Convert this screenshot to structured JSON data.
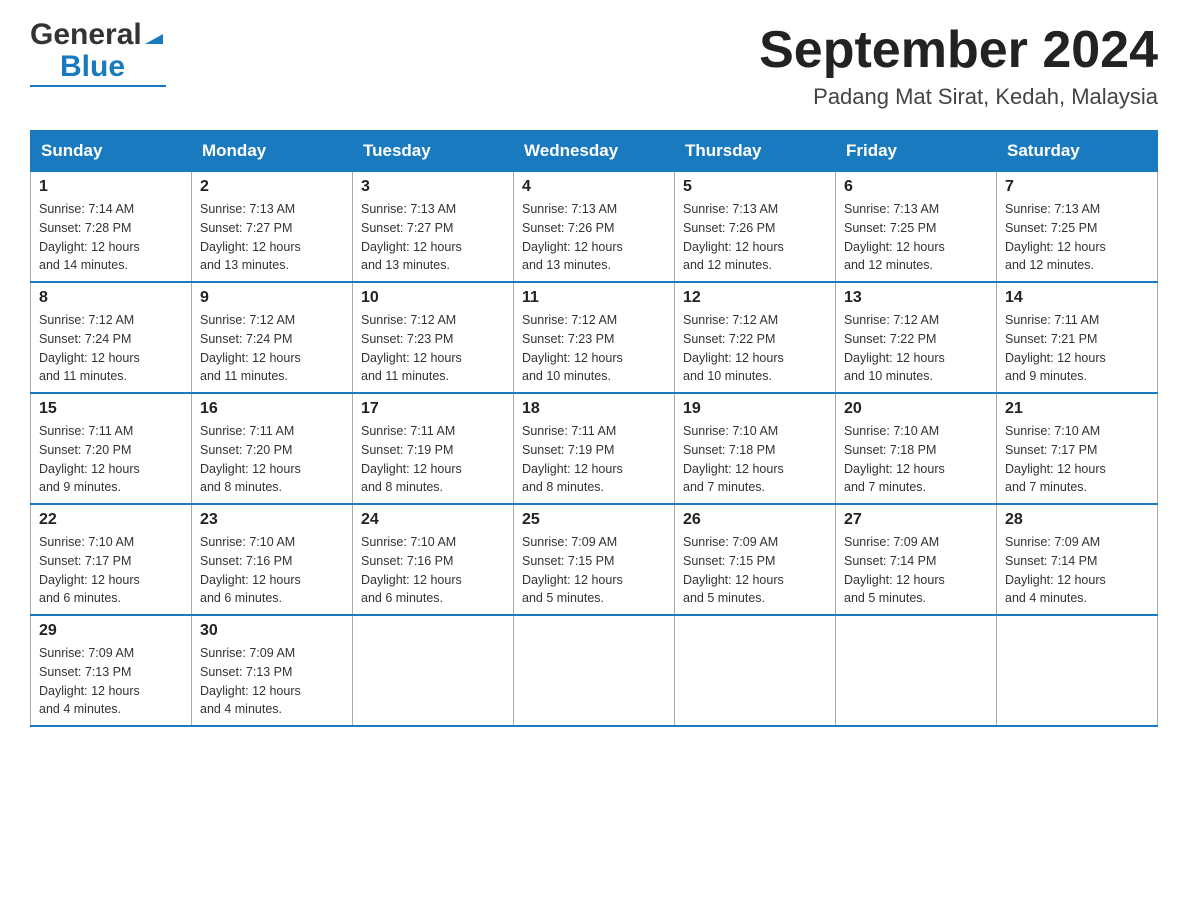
{
  "header": {
    "title": "September 2024",
    "subtitle": "Padang Mat Sirat, Kedah, Malaysia",
    "logo_general": "General",
    "logo_blue": "Blue"
  },
  "days_of_week": [
    "Sunday",
    "Monday",
    "Tuesday",
    "Wednesday",
    "Thursday",
    "Friday",
    "Saturday"
  ],
  "weeks": [
    [
      {
        "day": "1",
        "sunrise": "7:14 AM",
        "sunset": "7:28 PM",
        "daylight": "12 hours and 14 minutes."
      },
      {
        "day": "2",
        "sunrise": "7:13 AM",
        "sunset": "7:27 PM",
        "daylight": "12 hours and 13 minutes."
      },
      {
        "day": "3",
        "sunrise": "7:13 AM",
        "sunset": "7:27 PM",
        "daylight": "12 hours and 13 minutes."
      },
      {
        "day": "4",
        "sunrise": "7:13 AM",
        "sunset": "7:26 PM",
        "daylight": "12 hours and 13 minutes."
      },
      {
        "day": "5",
        "sunrise": "7:13 AM",
        "sunset": "7:26 PM",
        "daylight": "12 hours and 12 minutes."
      },
      {
        "day": "6",
        "sunrise": "7:13 AM",
        "sunset": "7:25 PM",
        "daylight": "12 hours and 12 minutes."
      },
      {
        "day": "7",
        "sunrise": "7:13 AM",
        "sunset": "7:25 PM",
        "daylight": "12 hours and 12 minutes."
      }
    ],
    [
      {
        "day": "8",
        "sunrise": "7:12 AM",
        "sunset": "7:24 PM",
        "daylight": "12 hours and 11 minutes."
      },
      {
        "day": "9",
        "sunrise": "7:12 AM",
        "sunset": "7:24 PM",
        "daylight": "12 hours and 11 minutes."
      },
      {
        "day": "10",
        "sunrise": "7:12 AM",
        "sunset": "7:23 PM",
        "daylight": "12 hours and 11 minutes."
      },
      {
        "day": "11",
        "sunrise": "7:12 AM",
        "sunset": "7:23 PM",
        "daylight": "12 hours and 10 minutes."
      },
      {
        "day": "12",
        "sunrise": "7:12 AM",
        "sunset": "7:22 PM",
        "daylight": "12 hours and 10 minutes."
      },
      {
        "day": "13",
        "sunrise": "7:12 AM",
        "sunset": "7:22 PM",
        "daylight": "12 hours and 10 minutes."
      },
      {
        "day": "14",
        "sunrise": "7:11 AM",
        "sunset": "7:21 PM",
        "daylight": "12 hours and 9 minutes."
      }
    ],
    [
      {
        "day": "15",
        "sunrise": "7:11 AM",
        "sunset": "7:20 PM",
        "daylight": "12 hours and 9 minutes."
      },
      {
        "day": "16",
        "sunrise": "7:11 AM",
        "sunset": "7:20 PM",
        "daylight": "12 hours and 8 minutes."
      },
      {
        "day": "17",
        "sunrise": "7:11 AM",
        "sunset": "7:19 PM",
        "daylight": "12 hours and 8 minutes."
      },
      {
        "day": "18",
        "sunrise": "7:11 AM",
        "sunset": "7:19 PM",
        "daylight": "12 hours and 8 minutes."
      },
      {
        "day": "19",
        "sunrise": "7:10 AM",
        "sunset": "7:18 PM",
        "daylight": "12 hours and 7 minutes."
      },
      {
        "day": "20",
        "sunrise": "7:10 AM",
        "sunset": "7:18 PM",
        "daylight": "12 hours and 7 minutes."
      },
      {
        "day": "21",
        "sunrise": "7:10 AM",
        "sunset": "7:17 PM",
        "daylight": "12 hours and 7 minutes."
      }
    ],
    [
      {
        "day": "22",
        "sunrise": "7:10 AM",
        "sunset": "7:17 PM",
        "daylight": "12 hours and 6 minutes."
      },
      {
        "day": "23",
        "sunrise": "7:10 AM",
        "sunset": "7:16 PM",
        "daylight": "12 hours and 6 minutes."
      },
      {
        "day": "24",
        "sunrise": "7:10 AM",
        "sunset": "7:16 PM",
        "daylight": "12 hours and 6 minutes."
      },
      {
        "day": "25",
        "sunrise": "7:09 AM",
        "sunset": "7:15 PM",
        "daylight": "12 hours and 5 minutes."
      },
      {
        "day": "26",
        "sunrise": "7:09 AM",
        "sunset": "7:15 PM",
        "daylight": "12 hours and 5 minutes."
      },
      {
        "day": "27",
        "sunrise": "7:09 AM",
        "sunset": "7:14 PM",
        "daylight": "12 hours and 5 minutes."
      },
      {
        "day": "28",
        "sunrise": "7:09 AM",
        "sunset": "7:14 PM",
        "daylight": "12 hours and 4 minutes."
      }
    ],
    [
      {
        "day": "29",
        "sunrise": "7:09 AM",
        "sunset": "7:13 PM",
        "daylight": "12 hours and 4 minutes."
      },
      {
        "day": "30",
        "sunrise": "7:09 AM",
        "sunset": "7:13 PM",
        "daylight": "12 hours and 4 minutes."
      },
      {
        "day": "",
        "sunrise": "",
        "sunset": "",
        "daylight": ""
      },
      {
        "day": "",
        "sunrise": "",
        "sunset": "",
        "daylight": ""
      },
      {
        "day": "",
        "sunrise": "",
        "sunset": "",
        "daylight": ""
      },
      {
        "day": "",
        "sunrise": "",
        "sunset": "",
        "daylight": ""
      },
      {
        "day": "",
        "sunrise": "",
        "sunset": "",
        "daylight": ""
      }
    ]
  ]
}
